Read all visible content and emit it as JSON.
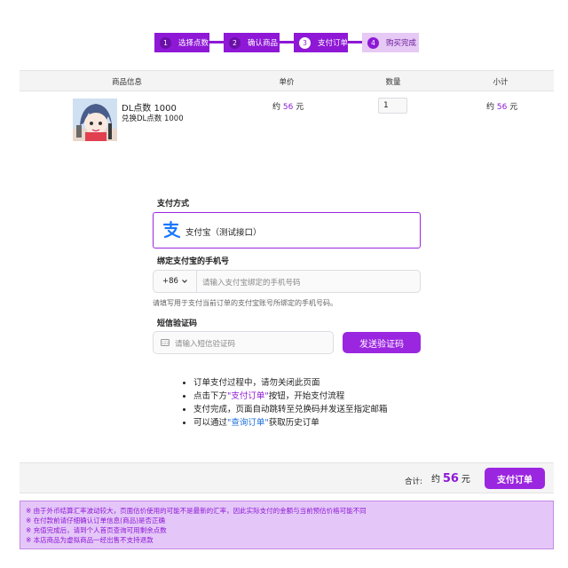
{
  "steps": [
    {
      "num": "1",
      "label": "选择点数",
      "state": "done"
    },
    {
      "num": "2",
      "label": "确认商品",
      "state": "done"
    },
    {
      "num": "3",
      "label": "支付订单",
      "state": "current"
    },
    {
      "num": "4",
      "label": "购买完成",
      "state": "todo"
    }
  ],
  "table": {
    "headers": [
      "商品信息",
      "单价",
      "数量",
      "小计"
    ],
    "row": {
      "name": "DL点数 1000",
      "desc": "兑换DL点数 1000",
      "price_prefix": "约",
      "price_value": "56",
      "price_unit": "元",
      "quantity": "1",
      "subtotal_prefix": "约",
      "subtotal_value": "56",
      "subtotal_unit": "元"
    }
  },
  "payment": {
    "section_label": "支付方式",
    "method_label": "支付宝（测试接口）",
    "icon": "alipay-icon"
  },
  "phone": {
    "label": "绑定支付宝的手机号",
    "country_code": "+86",
    "placeholder": "请输入支付宝绑定的手机号码",
    "hint": "请填写用于支付当前订单的支付宝账号所绑定的手机号码。"
  },
  "sms": {
    "label": "短信验证码",
    "placeholder": "请输入短信验证码",
    "send_button": "发送验证码"
  },
  "tips": {
    "t1": "订单支付过程中，请勿关闭此页面",
    "t2_pre": "点击下方",
    "t2_link": "\"支付订单\"",
    "t2_post": "按钮，开始支付流程",
    "t3": "支付完成，页面自动跳转至兑换码并发送至指定邮箱",
    "t4_pre": "可以通过",
    "t4_link": "\"查询订单\"",
    "t4_post": "获取历史订单"
  },
  "footer": {
    "total_label": "合计:",
    "total_prefix": "约",
    "total_value": "56",
    "total_unit": "元",
    "pay_button": "支付订单"
  },
  "notices": [
    "※ 由于外币结算汇率波动较大，页面估价使用的可能不是最新的汇率，因此实际支付的金额与当前预估价格可能不同",
    "※ 在付款前请仔细确认订单信息(商品)是否正确",
    "※ 充值完成后，请到个人首页查询可用剩余点数",
    "※ 本店商品为虚拟商品一经出售不支持退款"
  ],
  "colors": {
    "accent": "#8e18d6",
    "button": "#9b26e0",
    "notice_bg": "#e4c7f8",
    "link": "#1e6fd9"
  }
}
